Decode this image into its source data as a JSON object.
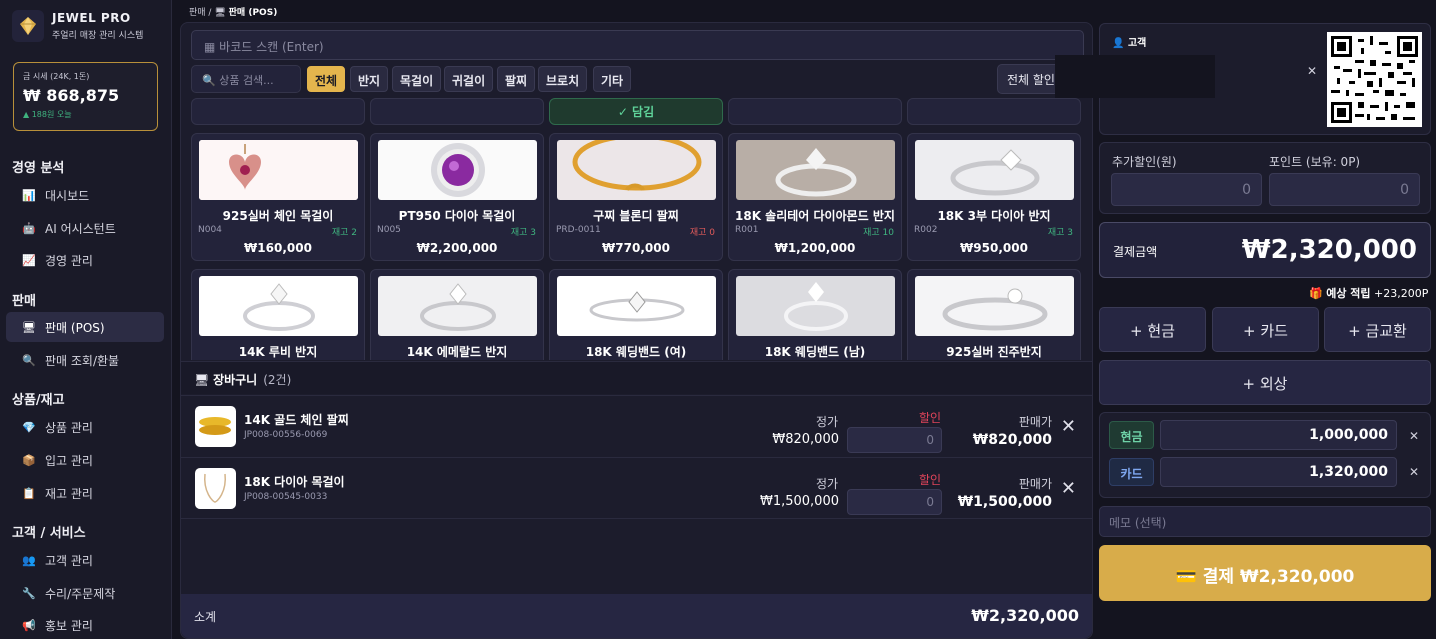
{
  "brand": {
    "name": "JEWEL PRO",
    "subtitle": "주얼리 매장 관리 시스템"
  },
  "gold": {
    "label": "금 시세 (24K, 1돈)",
    "price": "₩ 868,875",
    "change": "▲ 188원 오늘"
  },
  "sidebar": {
    "sections": [
      "경영 분석",
      "판매",
      "상품/재고",
      "고객 / 서비스"
    ],
    "items": [
      {
        "label": "대시보드",
        "icon": "bar-chart-icon",
        "glyph": "📊"
      },
      {
        "label": "AI 어시스턴트",
        "icon": "robot-icon",
        "glyph": "🤖"
      },
      {
        "label": "경영 관리",
        "icon": "trend-chart-icon",
        "glyph": "📈"
      },
      {
        "label": "판매 (POS)",
        "icon": "pos-icon",
        "glyph": "🖥"
      },
      {
        "label": "판매 조회/환불",
        "icon": "search-icon",
        "glyph": "🔍"
      },
      {
        "label": "상품 관리",
        "icon": "diamond-icon",
        "glyph": "💎"
      },
      {
        "label": "입고 관리",
        "icon": "box-icon",
        "glyph": "📦"
      },
      {
        "label": "재고 관리",
        "icon": "clipboard-icon",
        "glyph": "📋"
      },
      {
        "label": "고객 관리",
        "icon": "users-icon",
        "glyph": "👥"
      },
      {
        "label": "수리/주문제작",
        "icon": "wrench-icon",
        "glyph": "🔧"
      },
      {
        "label": "홍보 관리",
        "icon": "megaphone-icon",
        "glyph": "📢"
      }
    ]
  },
  "breadcrumb": {
    "parent": "판매 /",
    "current": "판매 (POS)"
  },
  "pos": {
    "barcode_placeholder": "바코드 스캔 (Enter)",
    "search_placeholder": "상품 검색...",
    "categories": [
      "전체",
      "반지",
      "목걸이",
      "귀걸이",
      "팔찌",
      "브로치",
      "기타"
    ],
    "discount_all": "전체 할인",
    "added_label": "✓ 담김",
    "products": [
      {
        "name": "925실버 체인 목걸이",
        "code": "N004",
        "stock": "재고 2",
        "price": "₩160,000"
      },
      {
        "name": "PT950 다이아 목걸이",
        "code": "N005",
        "stock": "재고 3",
        "price": "₩2,200,000"
      },
      {
        "name": "구찌 블론디 팔찌",
        "code": "PRD-0011",
        "stock": "재고 0",
        "price": "₩770,000"
      },
      {
        "name": "18K 솔리테어 다이아몬드 반지",
        "code": "R001",
        "stock": "재고 10",
        "price": "₩1,200,000"
      },
      {
        "name": "18K 3부 다이아 반지",
        "code": "R002",
        "stock": "재고 3",
        "price": "₩950,000"
      },
      {
        "name": "14K 루비 반지"
      },
      {
        "name": "14K 에메랄드 반지"
      },
      {
        "name": "18K 웨딩밴드 (여)"
      },
      {
        "name": "18K 웨딩밴드 (남)"
      },
      {
        "name": "925실버 진주반지"
      }
    ]
  },
  "cart": {
    "title": "장바구니",
    "count": "(2건)",
    "col_list": "정가",
    "col_discount": "할인",
    "col_sale": "판매가",
    "items": [
      {
        "name": "14K 골드 체인 팔찌",
        "code": "JP008-00556-0069",
        "list": "₩820,000",
        "discount": "0",
        "sale": "₩820,000"
      },
      {
        "name": "18K 다이아 목걸이",
        "code": "JP008-00545-0033",
        "list": "₩1,500,000",
        "discount": "0",
        "sale": "₩1,500,000"
      }
    ],
    "subtotal_label": "소계",
    "subtotal": "₩2,320,000"
  },
  "payment": {
    "customer_label": "고객",
    "extra_discount_label": "추가할인(원)",
    "extra_discount": "0",
    "points_label": "포인트 (보유: 0P)",
    "points": "0",
    "amount_label": "결제금액",
    "amount": "₩2,320,000",
    "expected_points_label": "예상 적립",
    "expected_points": "+23,200P",
    "methods": [
      "+ 현금",
      "+ 카드",
      "+ 금교환",
      "+ 외상"
    ],
    "splits": [
      {
        "method": "현금",
        "amount": "1,000,000"
      },
      {
        "method": "카드",
        "amount": "1,320,000"
      }
    ],
    "memo_placeholder": "메모 (선택)",
    "pay_button": "결제 ₩2,320,000"
  },
  "colors": {
    "accent": "#e4b54d",
    "pay": "#d8ac4a",
    "stock_ok": "#3fb37f",
    "stock_zero": "#e05a5a",
    "discount": "#e0445a"
  }
}
